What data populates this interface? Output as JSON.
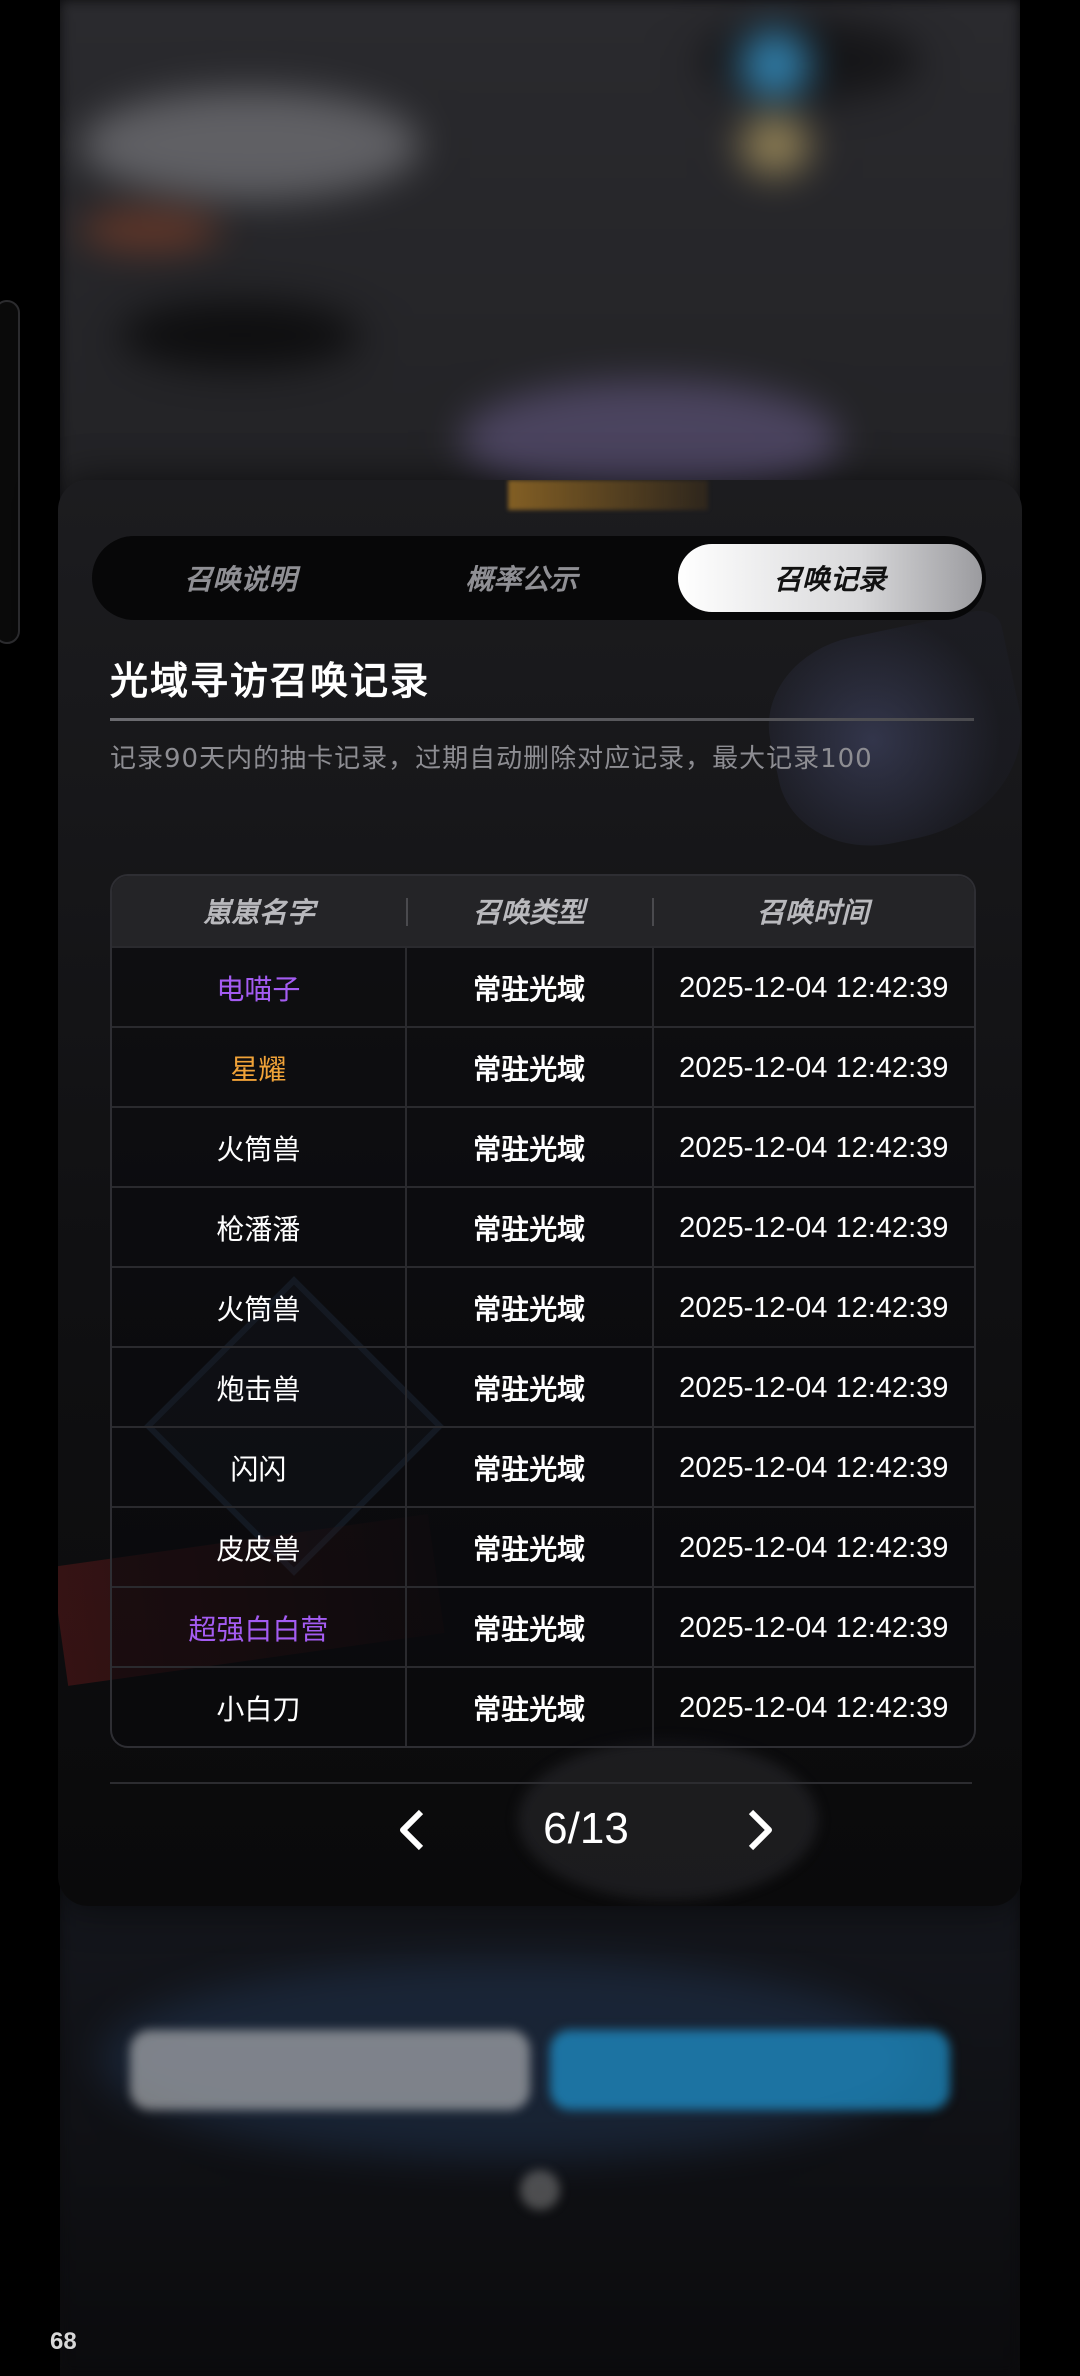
{
  "dialog": {
    "tabs": [
      {
        "label": "召唤说明",
        "active": false
      },
      {
        "label": "概率公示",
        "active": false
      },
      {
        "label": "召唤记录",
        "active": true
      }
    ],
    "title": "光域寻访召唤记录",
    "description": "记录90天内的抽卡记录，过期自动删除对应记录，最大记录100",
    "table": {
      "headers": [
        "崽崽名字",
        "召唤类型",
        "召唤时间"
      ],
      "rows": [
        {
          "name": "电喵子",
          "type": "常驻光域",
          "time": "2025-12-04 12:42:39",
          "quality": "purple"
        },
        {
          "name": "星耀",
          "type": "常驻光域",
          "time": "2025-12-04 12:42:39",
          "quality": "orange"
        },
        {
          "name": "火筒兽",
          "type": "常驻光域",
          "time": "2025-12-04 12:42:39",
          "quality": "white"
        },
        {
          "name": "枪潘潘",
          "type": "常驻光域",
          "time": "2025-12-04 12:42:39",
          "quality": "white"
        },
        {
          "name": "火筒兽",
          "type": "常驻光域",
          "time": "2025-12-04 12:42:39",
          "quality": "white"
        },
        {
          "name": "炮击兽",
          "type": "常驻光域",
          "time": "2025-12-04 12:42:39",
          "quality": "white"
        },
        {
          "name": "闪闪",
          "type": "常驻光域",
          "time": "2025-12-04 12:42:39",
          "quality": "white"
        },
        {
          "name": "皮皮兽",
          "type": "常驻光域",
          "time": "2025-12-04 12:42:39",
          "quality": "white"
        },
        {
          "name": "超强白白营",
          "type": "常驻光域",
          "time": "2025-12-04 12:42:39",
          "quality": "purple"
        },
        {
          "name": "小白刀",
          "type": "常驻光域",
          "time": "2025-12-04 12:42:39",
          "quality": "white"
        }
      ]
    },
    "pager": {
      "current": 6,
      "total": 13,
      "label": "6/13"
    }
  },
  "fps_counter": "68",
  "colors": {
    "purple_quality": "#a45cf2",
    "orange_quality": "#f0a238",
    "white_quality": "#ffffff"
  },
  "icons": {
    "prev": "chevron-left-icon",
    "next": "chevron-right-icon"
  }
}
